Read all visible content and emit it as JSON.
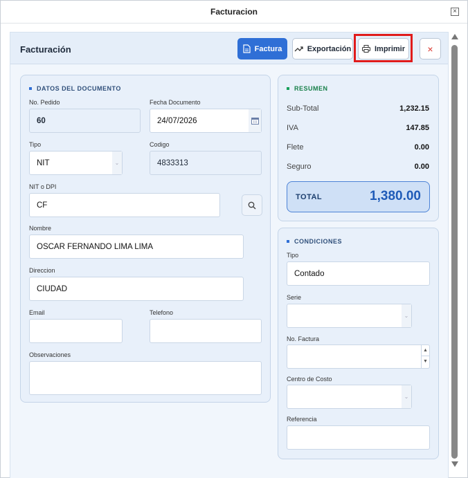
{
  "window": {
    "title": "Facturacion"
  },
  "header": {
    "title": "Facturación",
    "factura_label": "Factura",
    "exportacion_label": "Exportación",
    "imprimir_label": "Imprimir"
  },
  "documento": {
    "section_title": "DATOS DEL DOCUMENTO",
    "no_pedido_label": "No. Pedido",
    "no_pedido_value": "60",
    "fecha_label": "Fecha Documento",
    "fecha_value": "24/07/2026",
    "tipo_label": "Tipo",
    "tipo_value": "NIT",
    "codigo_label": "Codigo",
    "codigo_value": "4833313",
    "nit_label": "NIT o DPI",
    "nit_value": "CF",
    "nombre_label": "Nombre",
    "nombre_value": "OSCAR FERNANDO LIMA LIMA",
    "direccion_label": "Direccion",
    "direccion_value": "CIUDAD",
    "email_label": "Email",
    "email_value": "",
    "telefono_label": "Telefono",
    "telefono_value": "",
    "observaciones_label": "Observaciones",
    "observaciones_value": ""
  },
  "resumen": {
    "section_title": "RESUMEN",
    "rows": [
      {
        "label": "Sub-Total",
        "value": "1,232.15"
      },
      {
        "label": "IVA",
        "value": "147.85"
      },
      {
        "label": "Flete",
        "value": "0.00"
      },
      {
        "label": "Seguro",
        "value": "0.00"
      }
    ],
    "total_label": "TOTAL",
    "total_value": "1,380.00"
  },
  "condiciones": {
    "section_title": "CONDICIONES",
    "tipo_label": "Tipo",
    "tipo_value": "Contado",
    "serie_label": "Serie",
    "serie_value": "",
    "no_factura_label": "No. Factura",
    "no_factura_value": "",
    "centro_label": "Centro de Costo",
    "centro_value": "",
    "referencia_label": "Referencia",
    "referencia_value": ""
  },
  "colors": {
    "primary": "#2f6fd6",
    "highlight": "#e01b1b",
    "close": "#d9342b",
    "resumen_accent": "#18a05a"
  }
}
